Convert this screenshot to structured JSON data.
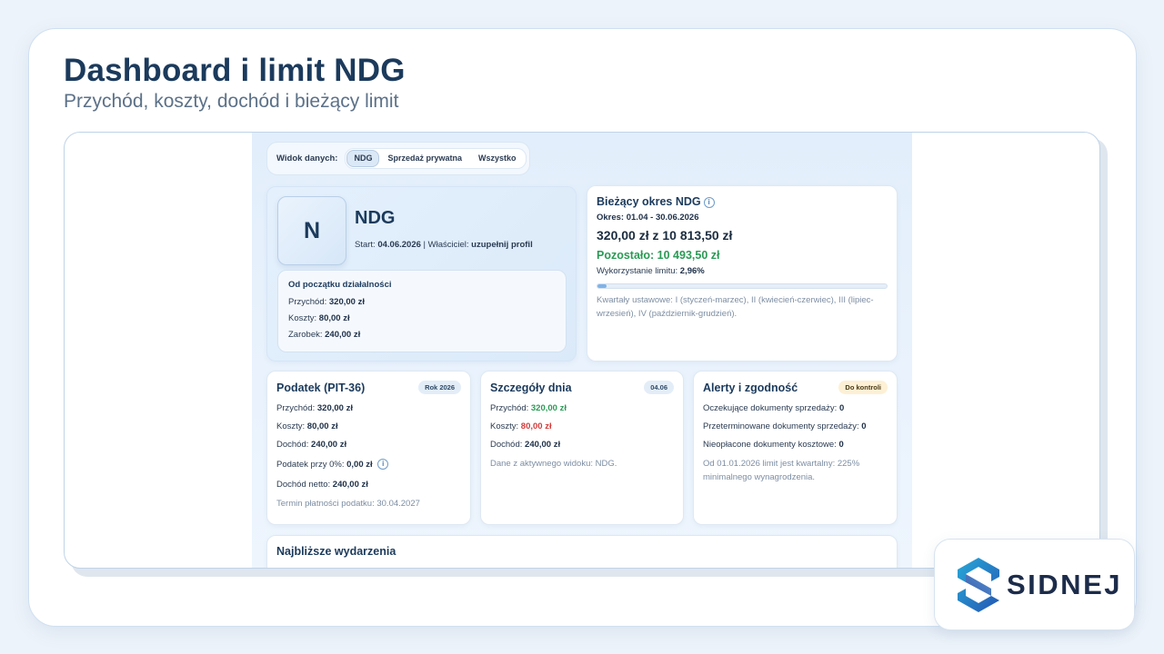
{
  "slide": {
    "title": "Dashboard i limit NDG",
    "subtitle": "Przychód, koszty, dochód i bieżący limit"
  },
  "view_toggle": {
    "label": "Widok danych:",
    "options": [
      "NDG",
      "Sprzedaż prywatna",
      "Wszystko"
    ],
    "selected": "NDG"
  },
  "profile": {
    "initial": "N",
    "name": "NDG",
    "start_label": "Start:",
    "start_value": "04.06.2026",
    "owner_label": "Właściciel:",
    "owner_value": "uzupełnij profil",
    "since_title": "Od początku działalności",
    "revenue_label": "Przychód:",
    "revenue_value": "320,00 zł",
    "costs_label": "Koszty:",
    "costs_value": "80,00 zł",
    "profit_label": "Zarobek:",
    "profit_value": "240,00 zł"
  },
  "period": {
    "title": "Bieżący okres NDG",
    "range": "Okres: 01.04 - 30.06.2026",
    "amount": "320,00 zł z 10 813,50 zł",
    "remaining": "Pozostało: 10 493,50 zł",
    "usage_label": "Wykorzystanie limitu:",
    "usage_value": "2,96%",
    "usage_fraction": 0.0296,
    "quarters_note": "Kwartały ustawowe: I (styczeń-marzec), II (kwiecień-czerwiec), III (lipiec-wrzesień), IV (październik-grudzień)."
  },
  "tax": {
    "title": "Podatek (PIT-36)",
    "badge": "Rok 2026",
    "revenue_label": "Przychód:",
    "revenue_value": "320,00 zł",
    "costs_label": "Koszty:",
    "costs_value": "80,00 zł",
    "income_label": "Dochód:",
    "income_value": "240,00 zł",
    "tax_label": "Podatek przy 0%:",
    "tax_value": "0,00 zł",
    "net_label": "Dochód netto:",
    "net_value": "240,00 zł",
    "deadline": "Termin płatności podatku: 30.04.2027"
  },
  "day": {
    "title": "Szczegóły dnia",
    "badge": "04.06",
    "revenue_label": "Przychód:",
    "revenue_value": "320,00 zł",
    "costs_label": "Koszty:",
    "costs_value": "80,00 zł",
    "income_label": "Dochód:",
    "income_value": "240,00 zł",
    "note": "Dane z aktywnego widoku: NDG."
  },
  "alerts": {
    "title": "Alerty i zgodność",
    "badge": "Do kontroli",
    "pending_label": "Oczekujące dokumenty sprzedaży:",
    "pending_value": "0",
    "overdue_label": "Przeterminowane dokumenty sprzedaży:",
    "overdue_value": "0",
    "unpaid_label": "Nieopłacone dokumenty kosztowe:",
    "unpaid_value": "0",
    "note": "Od 01.01.2026 limit jest kwartalny: 225% minimalnego wynagrodzenia."
  },
  "events": {
    "title": "Najbliższe wydarzenia"
  },
  "logo": {
    "text": "SIDNEJ"
  },
  "colors": {
    "accent": "#1b3a5c",
    "positive": "#2a9a55",
    "negative": "#d33a3a",
    "progress": "#7fb3e8"
  }
}
